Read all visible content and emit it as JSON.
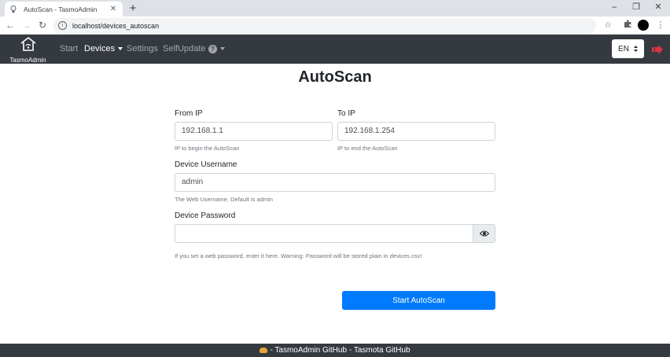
{
  "browser": {
    "tab_title": "AutoScan - TasmoAdmin",
    "url": "localhost/devices_autoscan",
    "tab_close": "✕",
    "new_tab": "+",
    "minimize": "–",
    "restore": "❐",
    "close": "✕"
  },
  "navbar": {
    "brand_label": "TasmoAdmin",
    "links": [
      "Start",
      "Devices",
      "Settings",
      "SelfUpdate"
    ],
    "help_icon": "?",
    "language": "EN",
    "colors": {
      "background": "#343a40",
      "logout": "#dc3545"
    }
  },
  "main": {
    "title": "AutoScan",
    "from_ip": {
      "label": "From IP",
      "value": "192.168.1.1",
      "help": "IP to begin the AutoScan"
    },
    "to_ip": {
      "label": "To IP",
      "value": "192.168.1.254",
      "help": "IP to end the AutoScan"
    },
    "username": {
      "label": "Device Username",
      "value": "admin",
      "help": "The Web Username. Default is admin"
    },
    "password": {
      "label": "Device Password",
      "value": "",
      "help": "If you set a web password, enter it here. Warning: Password will be stored plain in devices.csv!"
    },
    "submit_label": "Start AutoScan",
    "colors": {
      "primary": "#007bff"
    }
  },
  "footer": {
    "text": "- TasmoAdmin GitHub - Tasmota GitHub"
  }
}
